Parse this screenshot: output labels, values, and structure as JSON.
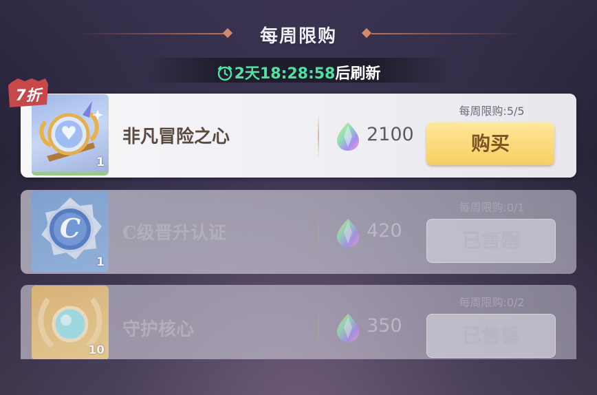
{
  "header": {
    "title": "每周限购"
  },
  "timer": {
    "value": "2天18:28:58",
    "suffix": "后刷新"
  },
  "discount_badge": "7折",
  "items": [
    {
      "name": "非凡冒险之心",
      "quantity": "1",
      "price": "2100",
      "limit": "每周限购:5/5",
      "button_label": "购买"
    },
    {
      "name": "C级晋升认证",
      "quantity": "1",
      "price": "420",
      "limit": "每周限购:0/1",
      "button_label": "已售罄"
    },
    {
      "name": "守护核心",
      "quantity": "10",
      "price": "350",
      "limit": "每周限购:0/2",
      "button_label": "已售罄"
    }
  ],
  "colors": {
    "timer": "#4fe3a2",
    "buy_button": "#f6cf63",
    "discount_badge": "#c6484a"
  },
  "icons": [
    "clock-icon",
    "adventure-heart-icon",
    "c-rank-badge-icon",
    "guardian-core-icon",
    "crystal-gem-icon"
  ]
}
